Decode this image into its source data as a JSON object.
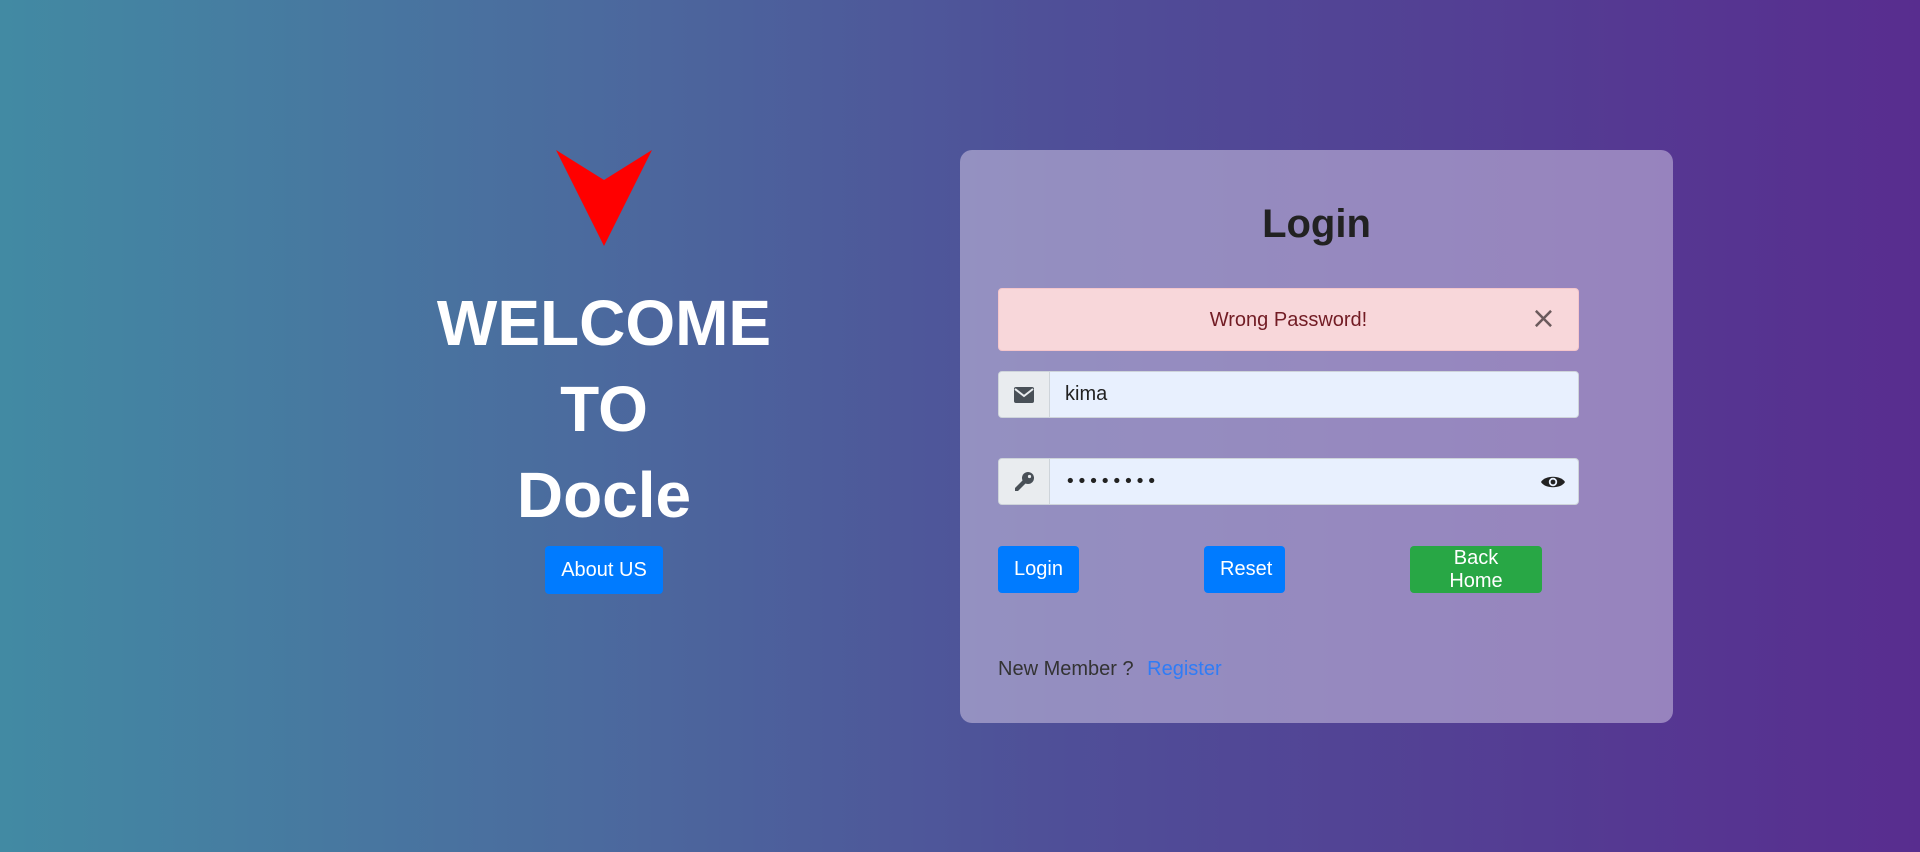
{
  "welcome": {
    "line1": "WELCOME TO",
    "line2": "Docle",
    "about_label": "About US",
    "logo_icon": "red-chevron-down-logo",
    "logo_color": "#ff0000"
  },
  "login": {
    "title": "Login",
    "alert_text": "Wrong Password!",
    "alert_close": "×",
    "email_icon": "envelope-icon",
    "email_value": "kima",
    "password_icon": "key-icon",
    "password_value": "kimakima",
    "password_toggle_icon": "eye-icon",
    "buttons": {
      "login": "Login",
      "reset": "Reset",
      "home": "Back Home"
    },
    "register_prompt": "New Member ?",
    "register_link": "Register"
  },
  "colors": {
    "primary": "#007bff",
    "success": "#28a745",
    "alert_bg": "#f8d7da",
    "alert_text": "#721c24"
  }
}
